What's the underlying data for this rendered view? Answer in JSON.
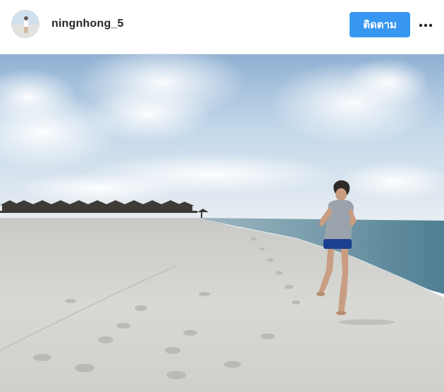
{
  "post": {
    "author": {
      "username": "ningnhong_5",
      "avatar": "profile-photo"
    },
    "follow_label": "ติดตาม",
    "more_icon": "more-horizontal-icon",
    "image": {
      "subject": "beach-running-photo"
    }
  },
  "colors": {
    "follow_button": "#3897f0",
    "username": "#262626",
    "header_border": "#efefef"
  }
}
